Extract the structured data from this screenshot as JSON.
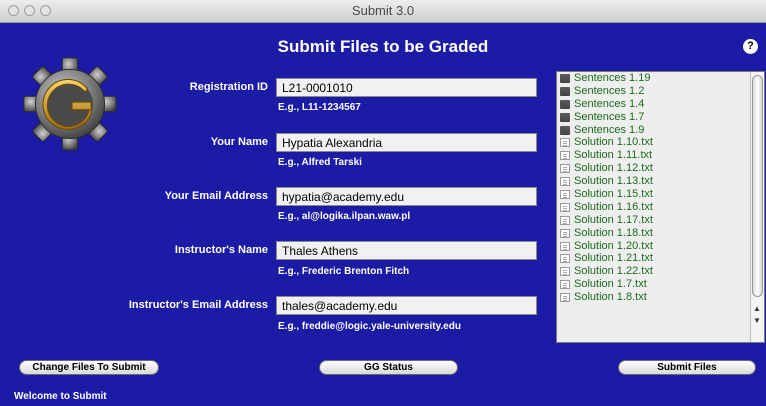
{
  "window": {
    "title": "Submit 3.0"
  },
  "heading": "Submit Files to be Graded",
  "help_label": "?",
  "icons": {
    "logo": "gear-g-logo",
    "help": "help-icon",
    "folder": "folder-icon",
    "document": "document-icon"
  },
  "form": {
    "fields": [
      {
        "label": "Registration ID",
        "value": "L21-0001010",
        "example": "E.g., L11-1234567"
      },
      {
        "label": "Your Name",
        "value": "Hypatia Alexandria",
        "example": "E.g., Alfred Tarski"
      },
      {
        "label": "Your Email Address",
        "value": "hypatia@academy.edu",
        "example": "E.g., al@logika.ilpan.waw.pl"
      },
      {
        "label": "Instructor's Name",
        "value": "Thales Athens",
        "example": "E.g., Frederic Brenton Fitch"
      },
      {
        "label": "Instructor's Email Address",
        "value": "thales@academy.edu",
        "example": "E.g., freddie@logic.yale-university.edu"
      }
    ]
  },
  "files": [
    {
      "name": "Sentences 1.19",
      "kind": "folder"
    },
    {
      "name": "Sentences 1.2",
      "kind": "folder"
    },
    {
      "name": "Sentences 1.4",
      "kind": "folder"
    },
    {
      "name": "Sentences 1.7",
      "kind": "folder"
    },
    {
      "name": "Sentences 1.9",
      "kind": "folder"
    },
    {
      "name": "Solution 1.10.txt",
      "kind": "document"
    },
    {
      "name": "Solution 1.11.txt",
      "kind": "document"
    },
    {
      "name": "Solution 1.12.txt",
      "kind": "document"
    },
    {
      "name": "Solution 1.13.txt",
      "kind": "document"
    },
    {
      "name": "Solution 1.15.txt",
      "kind": "document"
    },
    {
      "name": "Solution 1.16.txt",
      "kind": "document"
    },
    {
      "name": "Solution 1.17.txt",
      "kind": "document"
    },
    {
      "name": "Solution 1.18.txt",
      "kind": "document"
    },
    {
      "name": "Solution 1.20.txt",
      "kind": "document"
    },
    {
      "name": "Solution 1.21.txt",
      "kind": "document"
    },
    {
      "name": "Solution 1.22.txt",
      "kind": "document"
    },
    {
      "name": "Solution 1.7.txt",
      "kind": "document"
    },
    {
      "name": "Solution 1.8.txt",
      "kind": "document"
    }
  ],
  "buttons": {
    "change_files": "Change Files To Submit",
    "gg_status": "GG Status",
    "submit_files": "Submit Files"
  },
  "status_text": "Welcome to Submit",
  "colors": {
    "background": "#1b1ba6",
    "file_text": "#1d6b1d"
  }
}
